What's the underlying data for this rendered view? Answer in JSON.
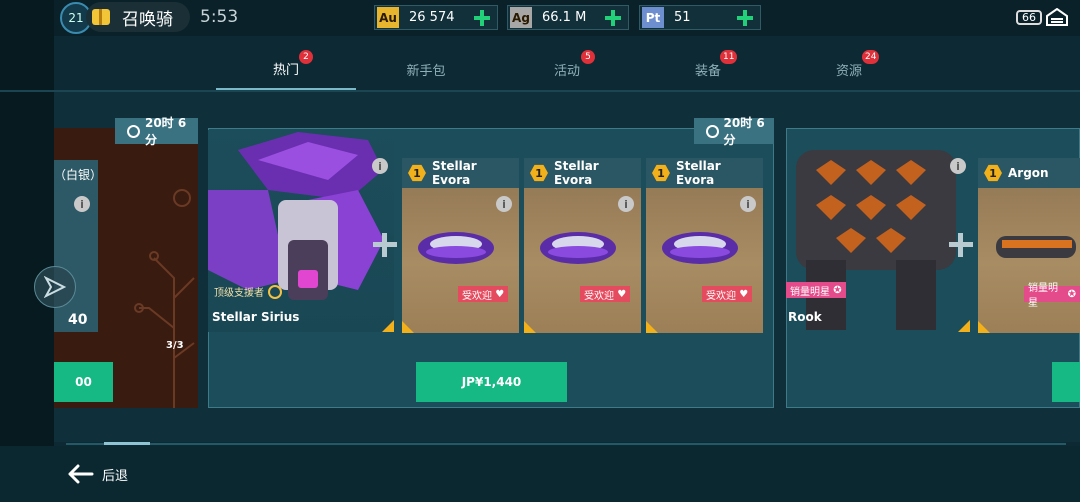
{
  "header": {
    "avatar_level": "21",
    "notice": "召唤骑",
    "time": "5:53",
    "level": "66",
    "currencies": [
      {
        "code": "Au",
        "value": "26 574",
        "color": "#e8b52e"
      },
      {
        "code": "Ag",
        "value": "66.1 M",
        "color": "#a7a7a7"
      },
      {
        "code": "Pt",
        "value": "51",
        "color": "#6e8fcf"
      }
    ]
  },
  "tabs": [
    {
      "label": "热门",
      "badge": "2",
      "active": true
    },
    {
      "label": "新手包",
      "badge": ""
    },
    {
      "label": "活动",
      "badge": "5"
    },
    {
      "label": "装备",
      "badge": "11"
    },
    {
      "label": "资源",
      "badge": "24"
    }
  ],
  "offers": {
    "left": {
      "timer": "20时 6分",
      "partial_text": "（白银）",
      "count": "40",
      "pages": "3/3",
      "price_fragment": "00"
    },
    "main": {
      "timer": "20时 6分",
      "robot_name": "Stellar Sirius",
      "robot_role": "顶级支援者",
      "items": [
        {
          "level": "1",
          "name": "Stellar Evora",
          "tag": "受欢迎"
        },
        {
          "level": "1",
          "name": "Stellar Evora",
          "tag": "受欢迎"
        },
        {
          "level": "1",
          "name": "Stellar Evora",
          "tag": "受欢迎"
        }
      ],
      "price": "JP¥1,440"
    },
    "right": {
      "robot_name": "Rook",
      "robot_tag": "销量明星",
      "item": {
        "level": "1",
        "name": "Argon",
        "tag": "销量明星"
      }
    }
  },
  "footer": {
    "back_label": "后退"
  },
  "icons": {
    "info": "i",
    "clock": "clock-icon",
    "back": "back-arrow-icon",
    "share": "share-icon",
    "garage": "garage-icon"
  }
}
